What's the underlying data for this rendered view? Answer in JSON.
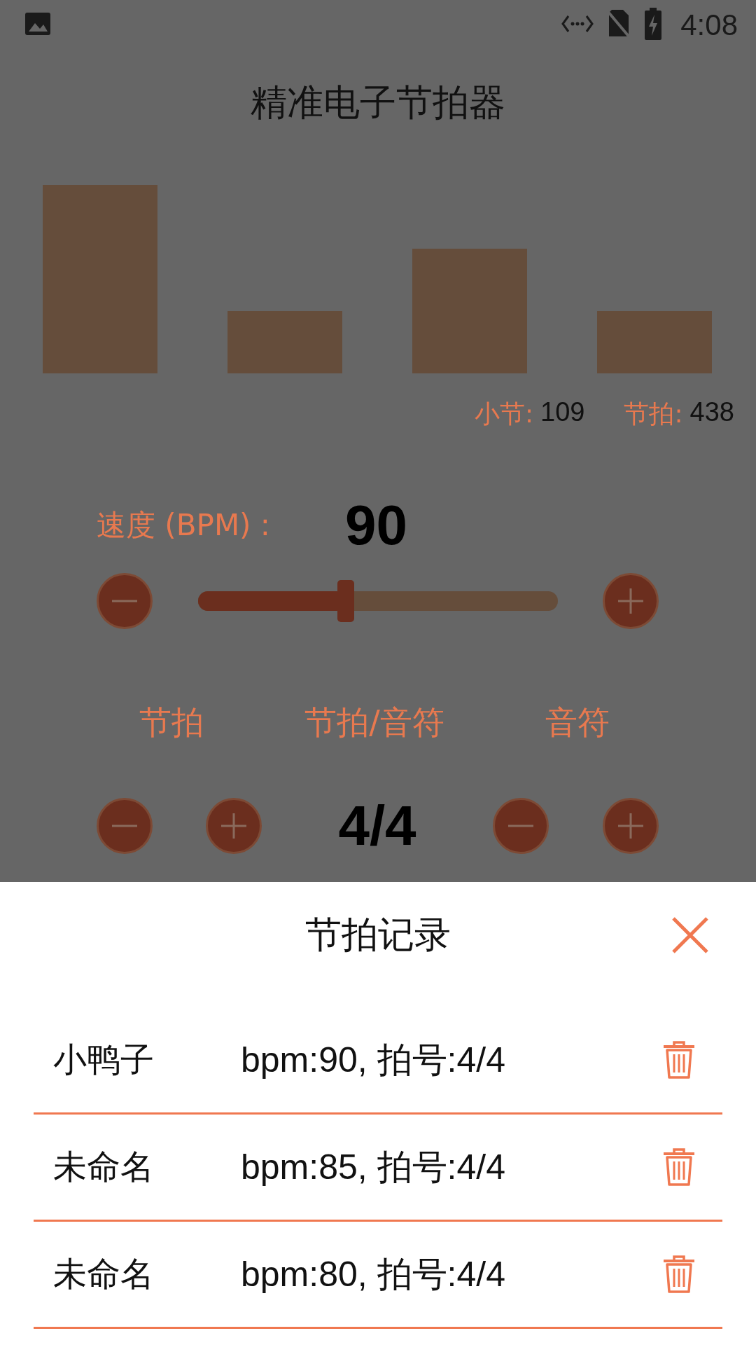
{
  "status_bar": {
    "time": "4:08"
  },
  "title": "精准电子节拍器",
  "beats": [
    {
      "kind": "strong"
    },
    {
      "kind": "weak"
    },
    {
      "kind": "medium"
    },
    {
      "kind": "weak"
    }
  ],
  "counters": [
    {
      "label": "小节:",
      "value": "109"
    },
    {
      "label": "节拍:",
      "value": "438"
    }
  ],
  "tempo": {
    "label": "速度 (BPM) :",
    "value": "90",
    "level": 0.41
  },
  "signature": {
    "labels": [
      "节拍",
      "节拍/音符",
      "音符"
    ],
    "value": "4/4"
  },
  "records_sheet": {
    "title": "节拍记录",
    "records": [
      {
        "name": "小鸭子",
        "detail": "bpm:90, 拍号:4/4"
      },
      {
        "name": "未命名",
        "detail": "bpm:85, 拍号:4/4"
      },
      {
        "name": "未命名",
        "detail": "bpm:80, 拍号:4/4"
      }
    ]
  }
}
